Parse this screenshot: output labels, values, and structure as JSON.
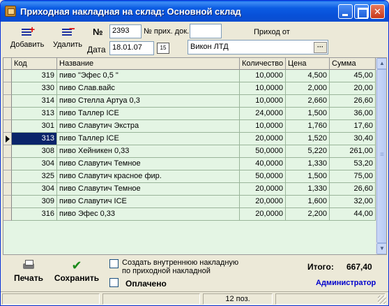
{
  "window": {
    "title": "Приходная накладная на склад: Основной склад"
  },
  "toolbar": {
    "add_label": "Добавить",
    "delete_label": "Удалить",
    "num_label": "№",
    "num_value": "2393",
    "in_doc_label": "№ прих. док.",
    "in_doc_value": "",
    "from_label": "Приход от",
    "date_label": "Дата",
    "date_value": "18.01.07",
    "calendar_glyph": "15",
    "supplier_value": "Викон ЛТД",
    "supplier_btn": "···"
  },
  "grid": {
    "columns": [
      "Код",
      "Название",
      "Количество",
      "Цена",
      "Сумма"
    ],
    "current_row": 5,
    "rows": [
      [
        "319",
        "пиво \"Эфес 0,5 \"",
        "10,0000",
        "4,500",
        "45,00"
      ],
      [
        "330",
        "пиво Слав.вайс",
        "10,0000",
        "2,000",
        "20,00"
      ],
      [
        "314",
        "пиво Стелла Артуа 0,3",
        "10,0000",
        "2,660",
        "26,60"
      ],
      [
        "313",
        "пиво Таллер ICE",
        "24,0000",
        "1,500",
        "36,00"
      ],
      [
        "301",
        "пиво Славутич Экстра",
        "10,0000",
        "1,760",
        "17,60"
      ],
      [
        "313",
        "пиво Таллер ICE",
        "20,0000",
        "1,520",
        "30,40"
      ],
      [
        "308",
        "пиво Хейникен 0,33",
        "50,0000",
        "5,220",
        "261,00"
      ],
      [
        "304",
        "пиво Славутич Темное",
        "40,0000",
        "1,330",
        "53,20"
      ],
      [
        "325",
        "пиво Славутич красное фир.",
        "50,0000",
        "1,500",
        "75,00"
      ],
      [
        "304",
        "пиво Славутич Темное",
        "20,0000",
        "1,330",
        "26,60"
      ],
      [
        "309",
        "пиво Славутич ICE",
        "20,0000",
        "1,600",
        "32,00"
      ],
      [
        "316",
        "пиво Эфес 0,33",
        "20,0000",
        "2,200",
        "44,00"
      ]
    ]
  },
  "bottom": {
    "print_label": "Печать",
    "save_label": "Сохранить",
    "internal_checkbox_label": "Создать  внутреннюю накладную по приходной накладной",
    "internal_checked": false,
    "paid_label": "Оплачено",
    "paid_checked": false,
    "total_label": "Итого:",
    "total_value": "667,40",
    "user": "Администратор"
  },
  "status": {
    "items_count": "12 поз."
  },
  "colors": {
    "grid_bg": "#e4f5e4",
    "selection": "#0a246a",
    "user_text": "#0000cc",
    "titlebar": "#0850d8"
  }
}
